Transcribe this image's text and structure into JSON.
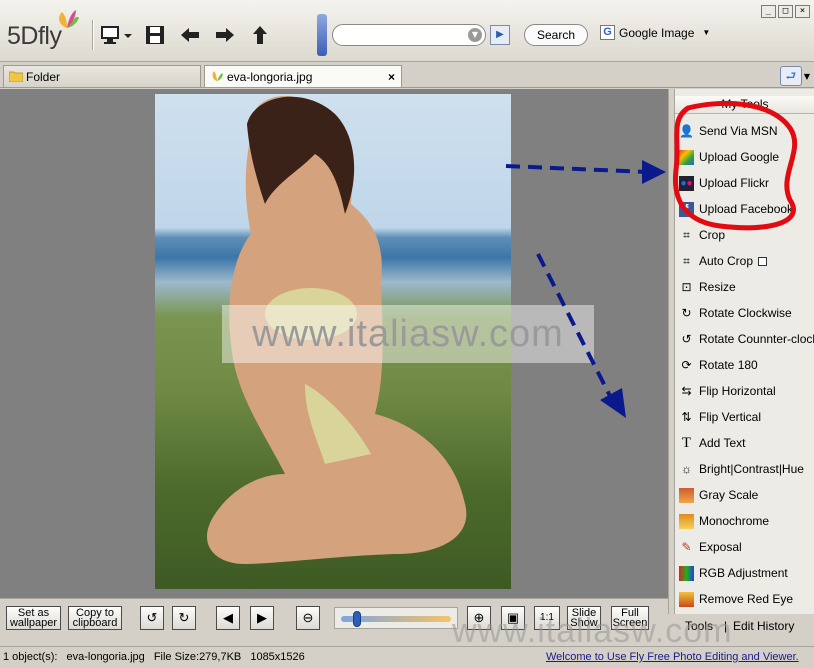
{
  "app": {
    "logo": "5Dfly",
    "window_controls": [
      "_",
      "□",
      "×"
    ]
  },
  "toolbar": {
    "icons": [
      "monitor-icon",
      "save-icon",
      "back-arrow-icon",
      "forward-arrow-icon",
      "up-arrow-icon"
    ],
    "search_value": "",
    "search_button": "Search",
    "engine_label": "Google Image",
    "engine_icon_letter": "G"
  },
  "tabs": [
    {
      "label": "Folder",
      "active": false
    },
    {
      "label": "eva-longoria.jpg",
      "active": true
    }
  ],
  "tab_close": "×",
  "sidebar": {
    "title": "My Tools",
    "items": [
      {
        "label": "Send Via MSN",
        "icon": "msn-icon"
      },
      {
        "label": "Upload Google",
        "icon": "google-upload-icon"
      },
      {
        "label": "Upload Flickr",
        "icon": "flickr-icon"
      },
      {
        "label": "Upload Facebook",
        "icon": "facebook-icon"
      },
      {
        "label": "Crop",
        "icon": "crop-icon"
      },
      {
        "label": "Auto Crop",
        "icon": "auto-crop-icon",
        "checkbox": true
      },
      {
        "label": "Resize",
        "icon": "resize-icon"
      },
      {
        "label": "Rotate Clockwise",
        "icon": "rotate-cw-icon"
      },
      {
        "label": "Rotate Counnter-clockwise",
        "icon": "rotate-ccw-icon"
      },
      {
        "label": "Rotate 180",
        "icon": "rotate-180-icon"
      },
      {
        "label": "Flip Horizontal",
        "icon": "flip-horizontal-icon"
      },
      {
        "label": "Flip Vertical",
        "icon": "flip-vertical-icon"
      },
      {
        "label": "Add Text",
        "icon": "add-text-icon"
      },
      {
        "label": "Bright|Contrast|Hue",
        "icon": "brightness-icon"
      },
      {
        "label": "Gray Scale",
        "icon": "grayscale-icon"
      },
      {
        "label": "Monochrome",
        "icon": "monochrome-icon"
      },
      {
        "label": "Exposal",
        "icon": "exposure-icon"
      },
      {
        "label": "RGB Adjustment",
        "icon": "rgb-icon"
      },
      {
        "label": "Remove Red Eye",
        "icon": "red-eye-icon"
      }
    ],
    "bottom_tabs": [
      "Tools",
      "Edit History"
    ]
  },
  "bottom_toolbar": {
    "wallpaper_line1": "Set as",
    "wallpaper_line2": "wallpaper",
    "clipboard_line1": "Copy to",
    "clipboard_line2": "clipboard",
    "actual_size": "1:1",
    "slideshow_line1": "Slide",
    "slideshow_line2": "Show",
    "fullscreen_line1": "Full",
    "fullscreen_line2": "Screen",
    "zoom_level": 0.12
  },
  "status": {
    "objects": "1 object(s):",
    "filename": "eva-longoria.jpg",
    "filesize": "File Size:279,7KB",
    "dimensions": "1085x1526",
    "welcome": "Welcome to Use Fly Free Photo Editing and Viewer."
  },
  "watermarks": {
    "center": "www.italiasw.com",
    "corner": "www.italiasw.com"
  },
  "colors": {
    "annotation_red": "#e30b12",
    "annotation_blue": "#0a1a8c",
    "viewer_bg": "#808080"
  }
}
